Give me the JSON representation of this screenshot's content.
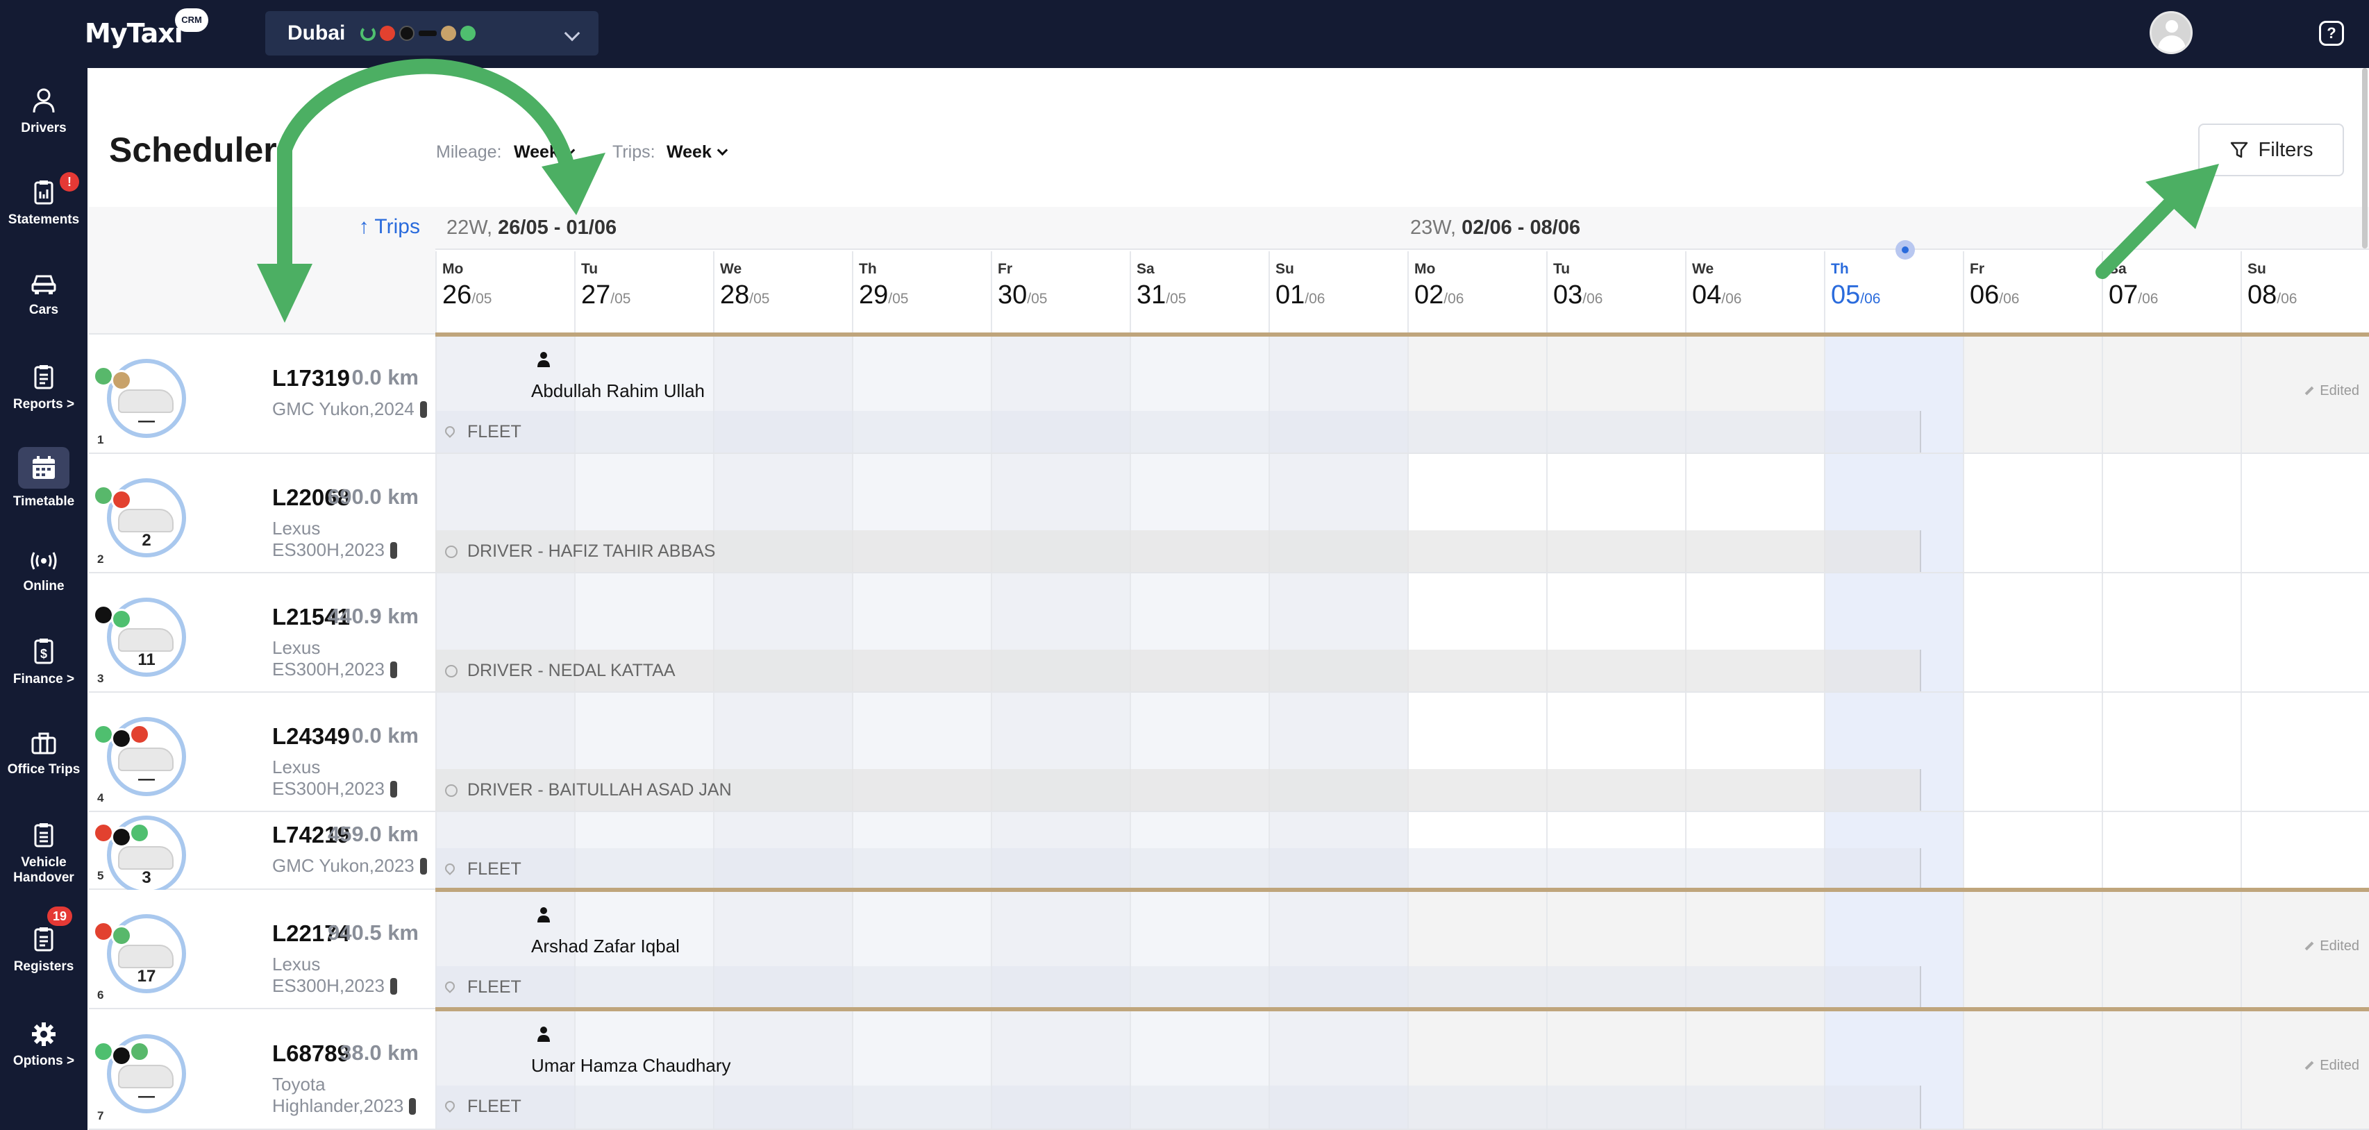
{
  "app": {
    "brand": "MyTaxi",
    "brand_badge": "CRM",
    "city": "Dubai",
    "city_providers": [
      "uber-ring",
      "careem",
      "yango",
      "bolt",
      "zed",
      "wheely"
    ]
  },
  "sidebar": {
    "items": [
      {
        "label": "Drivers",
        "icon": "driver-icon"
      },
      {
        "label": "Statements",
        "icon": "clipboard-icon",
        "badge": "!"
      },
      {
        "label": "Cars",
        "icon": "car-icon"
      },
      {
        "label": "Reports >",
        "icon": "report-icon"
      },
      {
        "label": "Timetable",
        "icon": "calendar-icon",
        "active": true
      },
      {
        "label": "Online",
        "icon": "broadcast-icon"
      },
      {
        "label": "Finance >",
        "icon": "dollar-doc-icon"
      },
      {
        "label": "Office Trips",
        "icon": "briefcase-icon"
      },
      {
        "label": "Vehicle Handover",
        "icon": "handover-icon"
      },
      {
        "label": "Registers",
        "icon": "register-icon",
        "badge": "19"
      },
      {
        "label": "Options >",
        "icon": "gear-icon"
      }
    ]
  },
  "header": {
    "title": "Scheduler",
    "mileage_label": "Mileage:",
    "mileage_value": "Week",
    "trips_label": "Trips:",
    "trips_value": "Week",
    "filters_label": "Filters",
    "trips_sort": "↑ Trips"
  },
  "weeks": [
    {
      "num": "22W,",
      "range": "26/05 - 01/06"
    },
    {
      "num": "23W,",
      "range": "02/06 - 08/06"
    }
  ],
  "days": [
    {
      "dn": "Mo",
      "dd": "26",
      "dm": "/05"
    },
    {
      "dn": "Tu",
      "dd": "27",
      "dm": "/05"
    },
    {
      "dn": "We",
      "dd": "28",
      "dm": "/05"
    },
    {
      "dn": "Th",
      "dd": "29",
      "dm": "/05"
    },
    {
      "dn": "Fr",
      "dd": "30",
      "dm": "/05"
    },
    {
      "dn": "Sa",
      "dd": "31",
      "dm": "/05"
    },
    {
      "dn": "Su",
      "dd": "01",
      "dm": "/06"
    },
    {
      "dn": "Mo",
      "dd": "02",
      "dm": "/06"
    },
    {
      "dn": "Tu",
      "dd": "03",
      "dm": "/06"
    },
    {
      "dn": "We",
      "dd": "04",
      "dm": "/06"
    },
    {
      "dn": "Th",
      "dd": "05",
      "dm": "/06",
      "today": true
    },
    {
      "dn": "Fr",
      "dd": "06",
      "dm": "/06"
    },
    {
      "dn": "Sa",
      "dd": "07",
      "dm": "/06"
    },
    {
      "dn": "Su",
      "dd": "08",
      "dm": "/06"
    }
  ],
  "cars": [
    {
      "index": "1",
      "plate": "L17319",
      "mileage": "0.0 km",
      "model": "GMC Yukon,2024",
      "count": "—",
      "providers": [
        "#58b86b",
        "#c8a26a"
      ],
      "assignee": "Abdullah Rahim Ullah",
      "band": "FLEET",
      "band_type": "fleet",
      "edited": "Edited"
    },
    {
      "index": "2",
      "plate": "L22068",
      "mileage": "690.0 km",
      "model": "Lexus ES300H,2023",
      "count": "2",
      "providers": [
        "#58b86b",
        "#e2412f"
      ],
      "assignee": "",
      "band": "DRIVER - HAFIZ TAHIR ABBAS",
      "band_type": "driver",
      "edited": ""
    },
    {
      "index": "3",
      "plate": "L21541",
      "mileage": "440.9 km",
      "model": "Lexus ES300H,2023",
      "count": "11",
      "providers": [
        "#111111",
        "#4fbf6f"
      ],
      "assignee": "",
      "band": "DRIVER - NEDAL KATTAA",
      "band_type": "driver",
      "edited": ""
    },
    {
      "index": "4",
      "plate": "L24349",
      "mileage": "0.0 km",
      "model": "Lexus ES300H,2023",
      "count": "—",
      "providers": [
        "#4fbf6f",
        "#111111",
        "#e2412f"
      ],
      "assignee": "",
      "band": "DRIVER - BAITULLAH ASAD JAN",
      "band_type": "driver",
      "edited": ""
    },
    {
      "index": "5",
      "plate": "L74219",
      "mileage": "459.0 km",
      "model": "GMC Yukon,2023",
      "count": "3",
      "providers": [
        "#e2412f",
        "#111111",
        "#4fbf6f"
      ],
      "assignee": "",
      "band": "FLEET",
      "band_type": "fleet",
      "edited": ""
    },
    {
      "index": "6",
      "plate": "L22174",
      "mileage": "940.5 km",
      "model": "Lexus ES300H,2023",
      "count": "17",
      "providers": [
        "#e2412f",
        "#58b86b"
      ],
      "assignee": "Arshad Zafar Iqbal",
      "band": "FLEET",
      "band_type": "fleet",
      "edited": "Edited"
    },
    {
      "index": "7",
      "plate": "L68789",
      "mileage": "38.0 km",
      "model": "Toyota Highlander,2023",
      "count": "—",
      "providers": [
        "#4fbf6f",
        "#111111",
        "#58b86b"
      ],
      "assignee": "Umar Hamza Chaudhary",
      "band": "FLEET",
      "band_type": "fleet",
      "edited": "Edited"
    }
  ],
  "colors": {
    "topbar": "#141b33",
    "accent": "#2a6bdc",
    "annotation_arrow": "#4caf63",
    "assignment_line": "#bfa57c"
  }
}
